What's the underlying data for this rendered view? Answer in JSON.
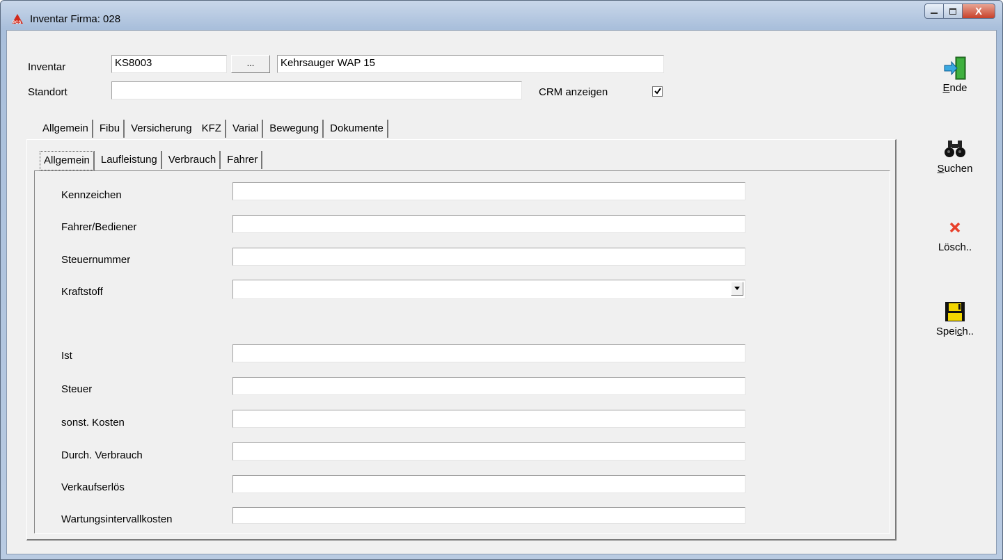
{
  "window": {
    "title": "Inventar Firma: 028",
    "close_symbol": "X",
    "app_icon_text": "PCS"
  },
  "header": {
    "inventar_label": "Inventar",
    "inventar_value": "KS8003",
    "browse_button": "...",
    "description_value": "Kehrsauger WAP 15",
    "standort_label": "Standort",
    "standort_value": "",
    "crm_label": "CRM anzeigen",
    "crm_checked": true
  },
  "tabs": [
    "Allgemein",
    "Fibu",
    "Versicherung",
    "KFZ",
    "Varial",
    "Bewegung",
    "Dokumente"
  ],
  "active_tab": "KFZ",
  "subtabs": [
    "Allgemein",
    "Laufleistung",
    "Verbrauch",
    "Fahrer"
  ],
  "active_subtab": "Allgemein",
  "fields": {
    "kennzeichen": {
      "label": "Kennzeichen",
      "value": ""
    },
    "fahrer": {
      "label": "Fahrer/Bediener",
      "value": ""
    },
    "steuernummer": {
      "label": "Steuernummer",
      "value": ""
    },
    "kraftstoff": {
      "label": "Kraftstoff",
      "value": ""
    },
    "ist": {
      "label": "Ist",
      "value": ""
    },
    "steuer": {
      "label": "Steuer",
      "value": ""
    },
    "sonst_kosten": {
      "label": "sonst. Kosten",
      "value": ""
    },
    "durch_verbrauch": {
      "label": "Durch. Verbrauch",
      "value": ""
    },
    "verkaufserloes": {
      "label": "Verkaufserlös",
      "value": ""
    },
    "wartung": {
      "label": "Wartungsintervallkosten",
      "value": ""
    }
  },
  "sidebar": {
    "ende": {
      "first": "E",
      "rest": "nde"
    },
    "suchen": {
      "first": "S",
      "rest": "uchen"
    },
    "loesch": {
      "label": "Lösch.."
    },
    "speich": {
      "pre": "Spei",
      "u": "c",
      "post": "h.."
    }
  },
  "colors": {
    "titlebar": "#b9cbe2",
    "client": "#f0f0f0",
    "delete_icon": "#e8402a",
    "save_icon": "#f2d600"
  }
}
